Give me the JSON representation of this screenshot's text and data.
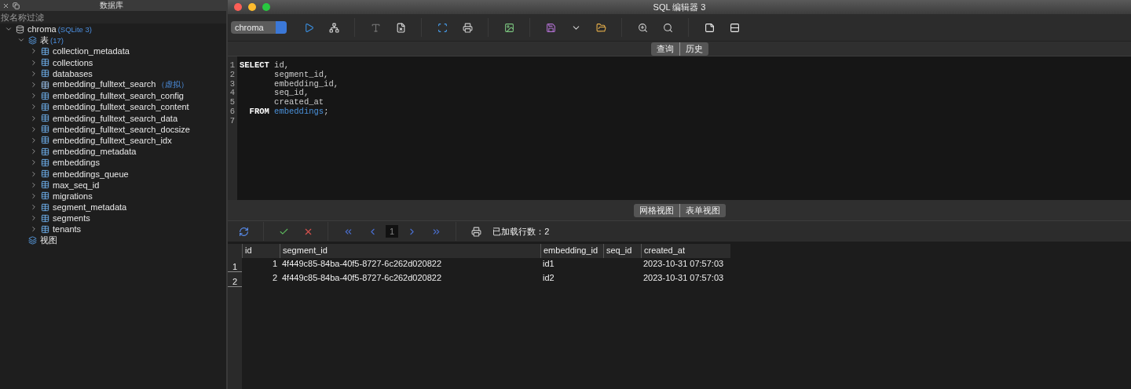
{
  "database_panel": {
    "title": "数据库",
    "filter": {
      "placeholder": "按名称过滤"
    },
    "tree": [
      {
        "label": "chroma",
        "tag": "(SQLite 3)",
        "kind": "database",
        "expanded": true,
        "children": [
          {
            "label": "表",
            "tag": "(17)",
            "kind": "folder",
            "expanded": true,
            "children": [
              {
                "label": "collection_metadata",
                "kind": "table",
                "expanded": false
              },
              {
                "label": "collections",
                "kind": "table",
                "expanded": false
              },
              {
                "label": "databases",
                "kind": "table",
                "expanded": false
              },
              {
                "label": "embedding_fulltext_search",
                "tag": "（虚拟）",
                "kind": "virtual",
                "expanded": false
              },
              {
                "label": "embedding_fulltext_search_config",
                "kind": "table",
                "expanded": false
              },
              {
                "label": "embedding_fulltext_search_content",
                "kind": "table",
                "expanded": false
              },
              {
                "label": "embedding_fulltext_search_data",
                "kind": "table",
                "expanded": false
              },
              {
                "label": "embedding_fulltext_search_docsize",
                "kind": "table",
                "expanded": false
              },
              {
                "label": "embedding_fulltext_search_idx",
                "kind": "table",
                "expanded": false
              },
              {
                "label": "embedding_metadata",
                "kind": "table",
                "expanded": false
              },
              {
                "label": "embeddings",
                "kind": "table",
                "expanded": false
              },
              {
                "label": "embeddings_queue",
                "kind": "table",
                "expanded": false
              },
              {
                "label": "max_seq_id",
                "kind": "table",
                "expanded": false
              },
              {
                "label": "migrations",
                "kind": "table",
                "expanded": false
              },
              {
                "label": "segment_metadata",
                "kind": "table",
                "expanded": false
              },
              {
                "label": "segments",
                "kind": "table",
                "expanded": false
              },
              {
                "label": "tenants",
                "kind": "table",
                "expanded": false
              }
            ]
          },
          {
            "label": "视图",
            "kind": "folder"
          }
        ]
      }
    ]
  },
  "window": {
    "title": "SQL 编辑器 3"
  },
  "toolbar": {
    "database_select": "chroma"
  },
  "editor_tabs": [
    "查询",
    "历史"
  ],
  "editor": {
    "lines": [
      {
        "number": "1",
        "tokens": [
          {
            "kind": "keyword",
            "text": "SELECT"
          },
          {
            "kind": "plain",
            "text": " id,"
          }
        ]
      },
      {
        "number": "2",
        "tokens": [
          {
            "kind": "plain",
            "text": "       segment_id,"
          }
        ]
      },
      {
        "number": "3",
        "tokens": [
          {
            "kind": "plain",
            "text": "       embedding_id,"
          }
        ]
      },
      {
        "number": "4",
        "tokens": [
          {
            "kind": "plain",
            "text": "       seq_id,"
          }
        ]
      },
      {
        "number": "5",
        "tokens": [
          {
            "kind": "plain",
            "text": "       created_at"
          }
        ]
      },
      {
        "number": "6",
        "tokens": [
          {
            "kind": "keyword",
            "text": "  FROM"
          },
          {
            "kind": "identifier",
            "text": " embeddings"
          },
          {
            "kind": "plain",
            "text": ";"
          }
        ]
      },
      {
        "number": "7"
      }
    ]
  },
  "result_tabs": [
    "网格视图",
    "表单视图"
  ],
  "grid_toolbar": {
    "page": "1",
    "status": "已加载行数：2"
  },
  "table": {
    "columns": [
      "id",
      "segment_id",
      "embedding_id",
      "seq_id",
      "created_at"
    ],
    "rows": [
      {
        "number": "1",
        "cells": [
          "1",
          "4f449c85-84ba-40f5-8727-6c262d020822",
          "id1",
          null,
          "2023-10-31 07:57:03"
        ]
      },
      {
        "number": "2",
        "cells": [
          "2",
          "4f449c85-84ba-40f5-8727-6c262d020822",
          "id2",
          null,
          "2023-10-31 07:57:03"
        ]
      }
    ]
  }
}
